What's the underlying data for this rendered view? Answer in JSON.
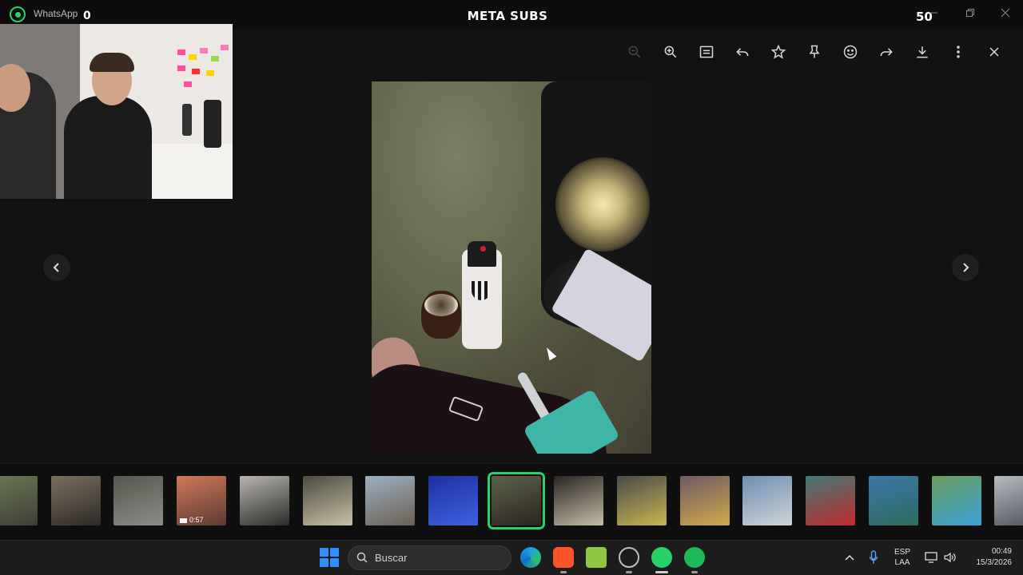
{
  "window": {
    "app_name": "WhatsApp",
    "left_counter": "0",
    "stream_title": "META SUBS",
    "right_counter": "50"
  },
  "toolbar": {
    "icons": [
      "zoom-out-icon",
      "zoom-in-icon",
      "caption-icon",
      "reply-icon",
      "star-icon",
      "pin-icon",
      "emoji-icon",
      "forward-icon",
      "download-icon",
      "more-icon",
      "close-icon"
    ]
  },
  "thumbnails": [
    {
      "name": "thumb-1",
      "color_a": "#6c7a55",
      "color_b": "#3e3e34"
    },
    {
      "name": "thumb-2",
      "color_a": "#7a6f60",
      "color_b": "#2f2a26"
    },
    {
      "name": "thumb-3",
      "color_a": "#56584f",
      "color_b": "#8a8c86"
    },
    {
      "name": "thumb-4",
      "color_a": "#d07a58",
      "color_b": "#5a3a32",
      "label": "0:57"
    },
    {
      "name": "thumb-5",
      "color_a": "#b7b5ad",
      "color_b": "#2d2b29"
    },
    {
      "name": "thumb-6",
      "color_a": "#4d4a40",
      "color_b": "#c7c1a4"
    },
    {
      "name": "thumb-7",
      "color_a": "#9db0c4",
      "color_b": "#6b6052"
    },
    {
      "name": "thumb-8",
      "color_a": "#1f2fa0",
      "color_b": "#3b63e0"
    },
    {
      "name": "thumb-9",
      "color_a": "#5d6148",
      "color_b": "#2b2521",
      "active": true
    },
    {
      "name": "thumb-10",
      "color_a": "#2a2523",
      "color_b": "#c4bda6"
    },
    {
      "name": "thumb-11",
      "color_a": "#4a4a4a",
      "color_b": "#c8b450"
    },
    {
      "name": "thumb-12",
      "color_a": "#6e5a63",
      "color_b": "#d1a94e"
    },
    {
      "name": "thumb-13",
      "color_a": "#6e8fb3",
      "color_b": "#cfd4d8"
    },
    {
      "name": "thumb-14",
      "color_a": "#3f7a77",
      "color_b": "#c12a2a"
    },
    {
      "name": "thumb-15",
      "color_a": "#3a78a8",
      "color_b": "#2f6a5e"
    },
    {
      "name": "thumb-16",
      "color_a": "#6c9c5c",
      "color_b": "#3aa2d8"
    },
    {
      "name": "thumb-17",
      "color_a": "#b8bcc1",
      "color_b": "#4b5058"
    }
  ],
  "taskbar": {
    "search_label": "Buscar",
    "lang_top": "ESP",
    "lang_bottom": "LAA",
    "time": "00:49",
    "date": "15/3/2026"
  },
  "colors": {
    "accent": "#25d366",
    "background": "#121212"
  }
}
